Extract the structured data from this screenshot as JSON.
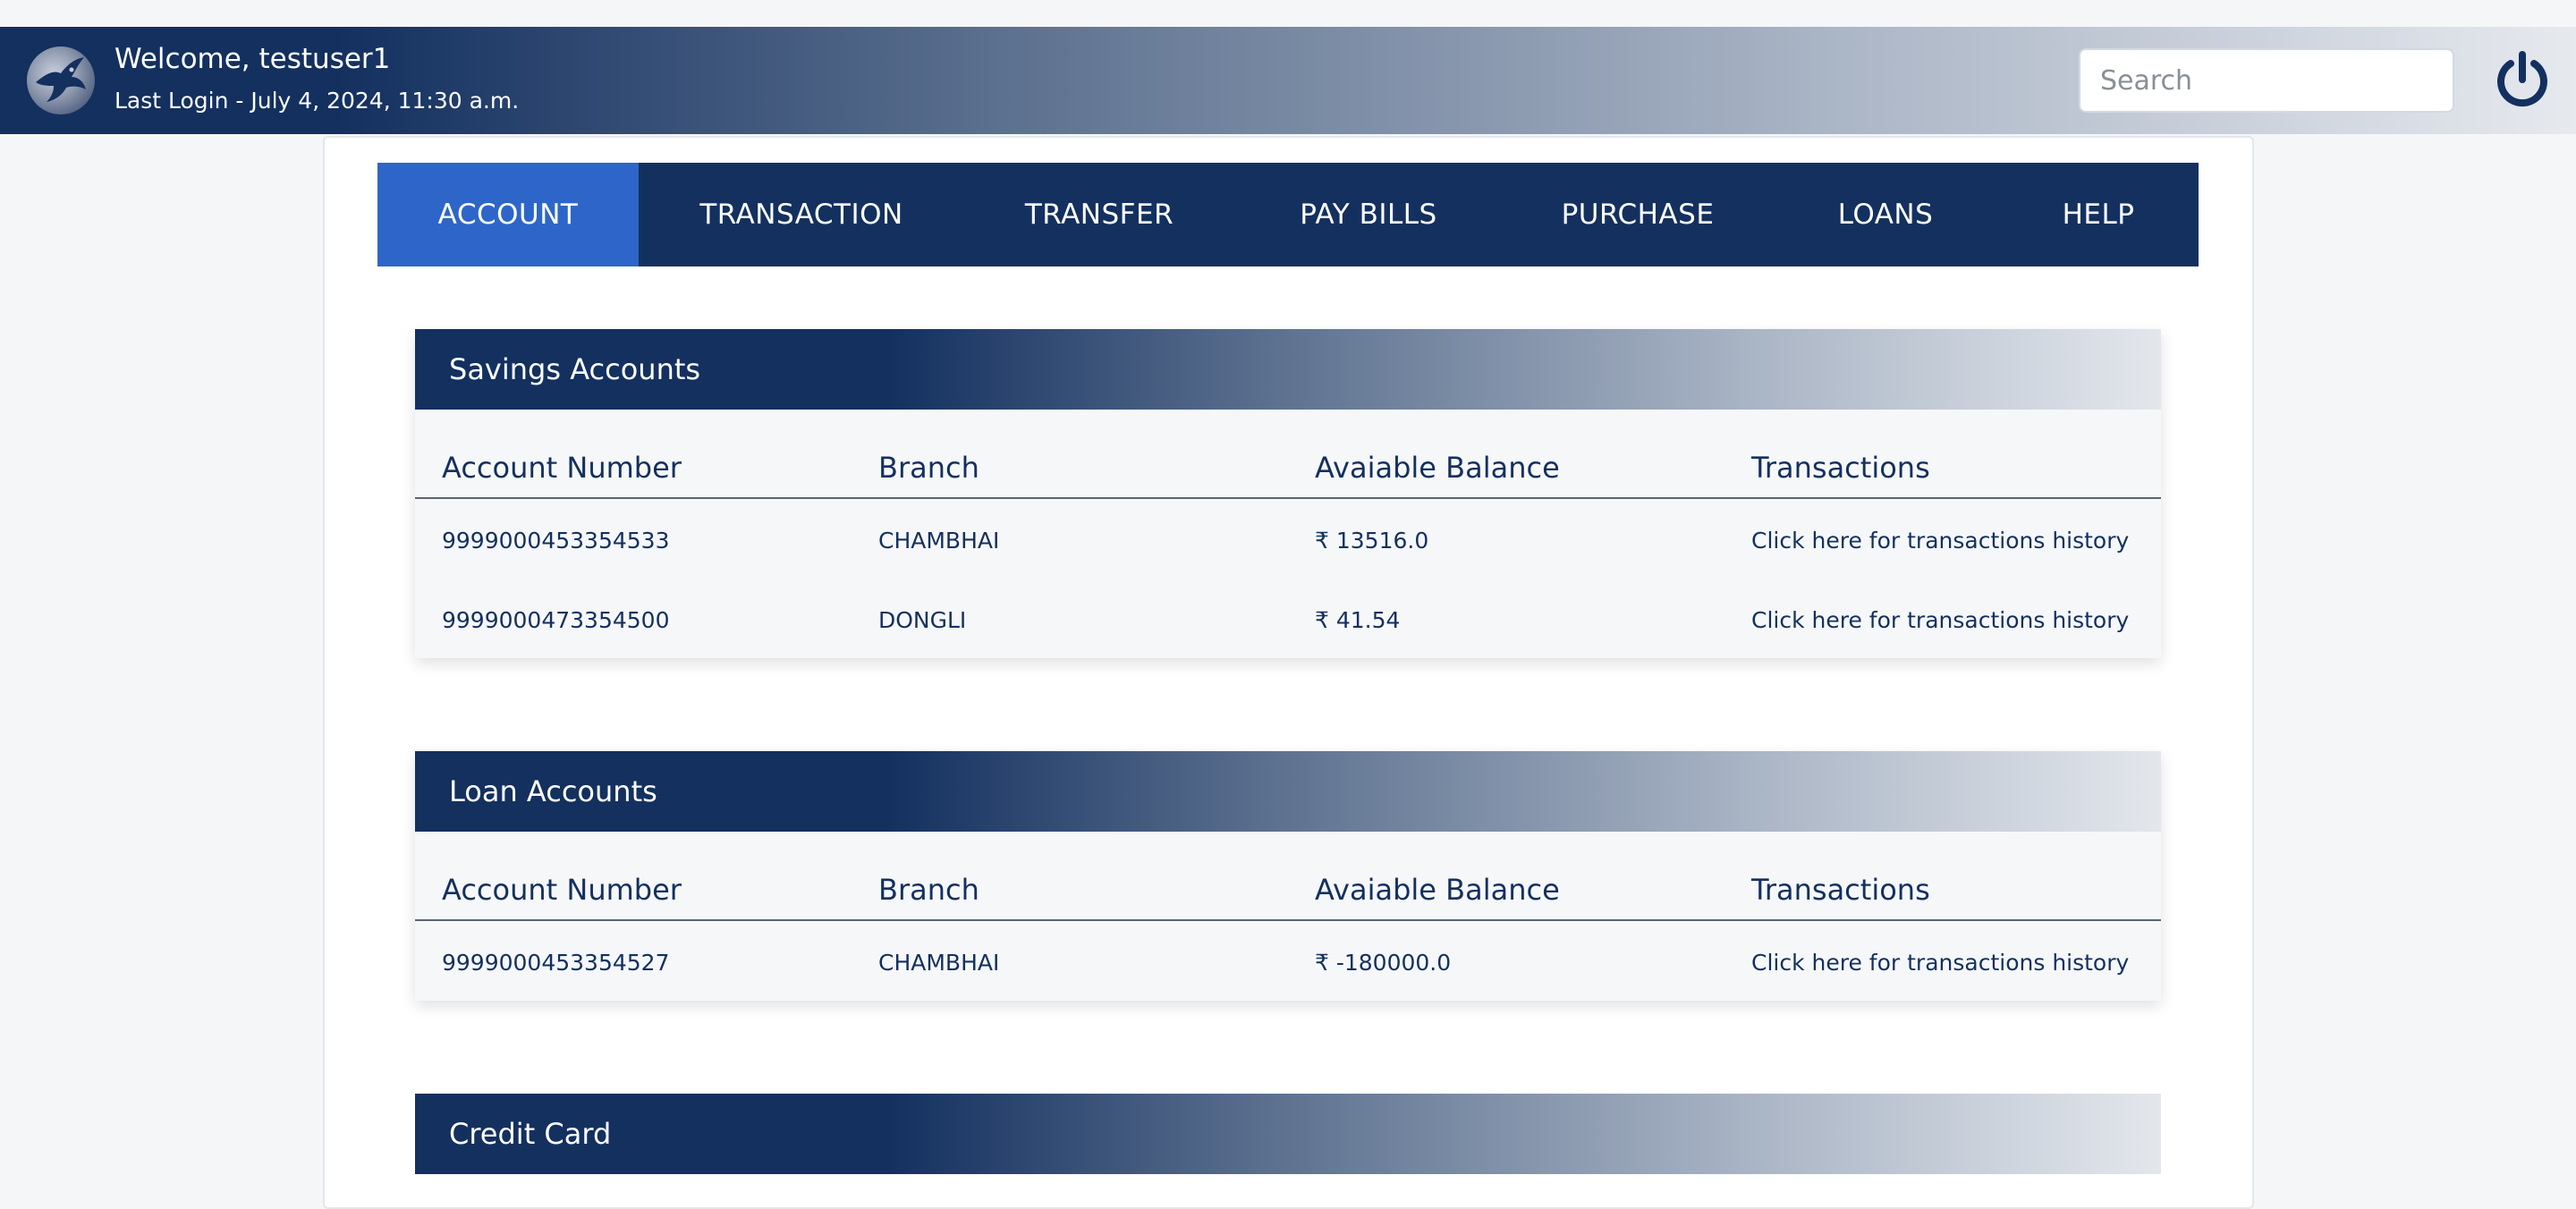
{
  "header": {
    "welcome": "Welcome, testuser1",
    "last_login": "Last Login - July 4, 2024, 11:30 a.m.",
    "search_placeholder": "Search",
    "avatar_icon": "eagle-logo-icon",
    "power_icon": "power-icon"
  },
  "nav": {
    "items": [
      {
        "label": "ACCOUNT",
        "active": true
      },
      {
        "label": "TRANSACTION",
        "active": false
      },
      {
        "label": "TRANSFER",
        "active": false
      },
      {
        "label": "PAY BILLS",
        "active": false
      },
      {
        "label": "PURCHASE",
        "active": false
      },
      {
        "label": "LOANS",
        "active": false
      },
      {
        "label": "HELP",
        "active": false
      }
    ]
  },
  "savings": {
    "title": "Savings Accounts",
    "columns": [
      "Account Number",
      "Branch",
      "Avaiable Balance",
      "Transactions"
    ],
    "rows": [
      {
        "account": "9999000453354533",
        "branch": "CHAMBHAI",
        "balance": "₹ 13516.0",
        "link": "Click here for transactions history"
      },
      {
        "account": "9999000473354500",
        "branch": "DONGLI",
        "balance": "₹ 41.54",
        "link": "Click here for transactions history"
      }
    ]
  },
  "loans": {
    "title": "Loan Accounts",
    "columns": [
      "Account Number",
      "Branch",
      "Avaiable Balance",
      "Transactions"
    ],
    "rows": [
      {
        "account": "9999000453354527",
        "branch": "CHAMBHAI",
        "balance": "₹ -180000.0",
        "link": "Click here for transactions history"
      }
    ]
  },
  "credit": {
    "title": "Credit Card"
  },
  "colors": {
    "navy": "#13305f",
    "active_tab": "#2d66c8",
    "card_bg": "#f6f7f9"
  }
}
